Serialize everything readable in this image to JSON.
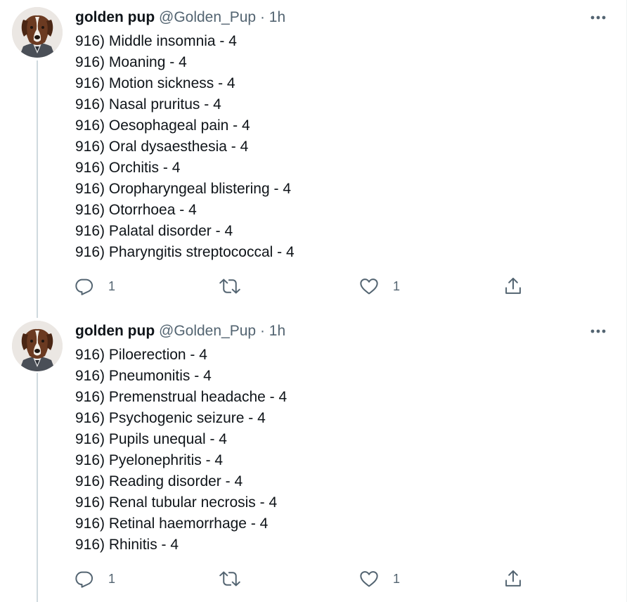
{
  "tweets": [
    {
      "name": "golden pup",
      "handle": "@Golden_Pup",
      "dot": "·",
      "time": "1h",
      "lines": [
        "916) Middle insomnia - 4",
        "916) Moaning - 4",
        "916) Motion sickness - 4",
        "916) Nasal pruritus - 4",
        "916) Oesophageal pain - 4",
        "916) Oral dysaesthesia - 4",
        "916) Orchitis - 4",
        "916) Oropharyngeal blistering - 4",
        "916) Otorrhoea - 4",
        "916) Palatal disorder - 4",
        "916) Pharyngitis streptococcal - 4"
      ],
      "replies": "1",
      "retweets": "",
      "likes": "1"
    },
    {
      "name": "golden pup",
      "handle": "@Golden_Pup",
      "dot": "·",
      "time": "1h",
      "lines": [
        "916) Piloerection - 4",
        "916) Pneumonitis - 4",
        "916) Premenstrual headache - 4",
        "916) Psychogenic seizure - 4",
        "916) Pupils unequal - 4",
        "916) Pyelonephritis - 4",
        "916) Reading disorder - 4",
        "916) Renal tubular necrosis - 4",
        "916) Retinal haemorrhage - 4",
        "916) Rhinitis - 4"
      ],
      "replies": "1",
      "retweets": "",
      "likes": "1"
    }
  ],
  "icons": {
    "reply": "reply-icon",
    "retweet": "retweet-icon",
    "like": "heart-icon",
    "share": "share-icon",
    "more": "more-icon"
  },
  "colors": {
    "text": "#0f1419",
    "secondary": "#536471",
    "thread_line": "#cfd9de"
  }
}
